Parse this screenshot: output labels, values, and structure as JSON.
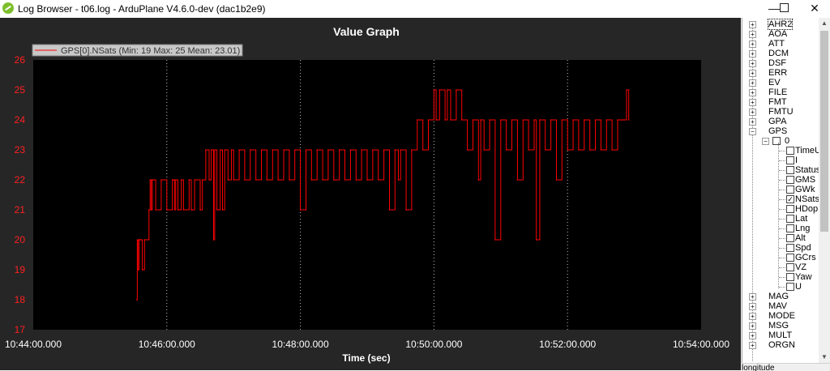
{
  "window": {
    "title": "Log Browser - t06.log -  ArduPlane V4.6.0-dev (dac1b2e9)",
    "minimize_glyph": "—",
    "close_glyph": "✕"
  },
  "graph": {
    "title": "Value Graph",
    "legend": "GPS[0].NSats  (Min: 19 Max: 25 Mean: 23.01)",
    "xlabel": "Time (sec)"
  },
  "chart_data": {
    "type": "line",
    "title": "Value Graph",
    "xlabel": "Time (sec)",
    "ylabel": "",
    "x_ticks": [
      "10:44:00.000",
      "10:46:00.000",
      "10:48:00.000",
      "10:50:00.000",
      "10:52:00.000",
      "10:54:00.000"
    ],
    "y_ticks": [
      "17",
      "18",
      "19",
      "20",
      "21",
      "22",
      "23",
      "24",
      "25",
      "26"
    ],
    "xlim_sec": [
      0,
      600
    ],
    "ylim": [
      17,
      26
    ],
    "grid": "vertical dotted",
    "legend_position": "top-left",
    "series": [
      {
        "name": "GPS[0].NSats  (Min: 19 Max: 25 Mean: 23.01)",
        "color": "#ff0000",
        "x_sec": [
          93,
          93.5,
          94,
          95,
          96,
          97,
          98,
          100,
          103,
          104,
          105,
          106,
          107,
          108,
          110,
          115,
          120,
          125,
          126,
          127,
          128,
          130,
          133,
          135,
          140,
          142,
          145,
          150,
          152,
          155,
          158,
          160,
          162,
          163,
          165,
          168,
          170,
          172,
          175,
          178,
          180,
          185,
          190,
          195,
          200,
          205,
          210,
          215,
          220,
          225,
          230,
          235,
          240,
          245,
          250,
          255,
          260,
          265,
          270,
          275,
          280,
          285,
          290,
          295,
          300,
          305,
          310,
          315,
          320,
          325,
          328,
          330,
          335,
          340,
          345,
          350,
          355,
          360,
          362,
          365,
          370,
          372,
          375,
          380,
          385,
          390,
          395,
          400,
          402,
          405,
          410,
          415,
          420,
          425,
          430,
          435,
          440,
          445,
          450,
          452,
          455,
          460,
          465,
          470,
          475,
          480,
          485,
          490,
          495,
          500,
          505,
          510,
          515,
          520,
          525,
          528,
          530,
          533,
          535
        ],
        "y": [
          18,
          20,
          19,
          20,
          20,
          20,
          19,
          20,
          20,
          21,
          22,
          21,
          22,
          22,
          21,
          22,
          21,
          22,
          22,
          21,
          22,
          21,
          22,
          21,
          22,
          21,
          22,
          21,
          22,
          23,
          22,
          23,
          20,
          23,
          21,
          23,
          21,
          23,
          22,
          23,
          22,
          23,
          22,
          23,
          22,
          23,
          22,
          23,
          22,
          23,
          22,
          23,
          21,
          23,
          22,
          23,
          22,
          23,
          22,
          23,
          22,
          23,
          22,
          23,
          22,
          23,
          22,
          23,
          21,
          23,
          22,
          23,
          21,
          23,
          24,
          23,
          24,
          25,
          24,
          25,
          24,
          25,
          24,
          25,
          24,
          23,
          24,
          22,
          24,
          23,
          24,
          20,
          24,
          23,
          24,
          22,
          24,
          23,
          24,
          20,
          24,
          23,
          24,
          22,
          24,
          23,
          24,
          23,
          24,
          23,
          24,
          23,
          24,
          23,
          24,
          24,
          24,
          25,
          24
        ]
      }
    ]
  },
  "tree": {
    "items": [
      {
        "label": "AHR2",
        "expanded": false
      },
      {
        "label": "AOA",
        "expanded": false
      },
      {
        "label": "ATT",
        "expanded": false
      },
      {
        "label": "DCM",
        "expanded": false
      },
      {
        "label": "DSF",
        "expanded": false
      },
      {
        "label": "ERR",
        "expanded": false
      },
      {
        "label": "EV",
        "expanded": false
      },
      {
        "label": "FILE",
        "expanded": false
      },
      {
        "label": "FMT",
        "expanded": false
      },
      {
        "label": "FMTU",
        "expanded": false
      },
      {
        "label": "GPA",
        "expanded": false
      },
      {
        "label": "GPS",
        "expanded": true
      }
    ],
    "gps_instance": "0",
    "gps_fields": [
      {
        "label": "TimeUS",
        "checked": false
      },
      {
        "label": "I",
        "checked": false
      },
      {
        "label": "Status",
        "checked": false
      },
      {
        "label": "GMS",
        "checked": false
      },
      {
        "label": "GWk",
        "checked": false
      },
      {
        "label": "NSats",
        "checked": true
      },
      {
        "label": "HDop",
        "checked": false
      },
      {
        "label": "Lat",
        "checked": false
      },
      {
        "label": "Lng",
        "checked": false
      },
      {
        "label": "Alt",
        "checked": false
      },
      {
        "label": "Spd",
        "checked": false
      },
      {
        "label": "GCrs",
        "checked": false
      },
      {
        "label": "VZ",
        "checked": false
      },
      {
        "label": "Yaw",
        "checked": false
      },
      {
        "label": "U",
        "checked": false
      }
    ],
    "after_items": [
      {
        "label": "MAG"
      },
      {
        "label": "MAV"
      },
      {
        "label": "MODE"
      },
      {
        "label": "MSG"
      },
      {
        "label": "MULT"
      },
      {
        "label": "ORGN"
      }
    ],
    "expand_glyph": "+",
    "collapse_glyph": "−",
    "check_glyph": "✓"
  },
  "statusbar": {
    "text": "longitude"
  },
  "scrollbar": {
    "up_glyph": "▲",
    "down_glyph": "▼"
  }
}
